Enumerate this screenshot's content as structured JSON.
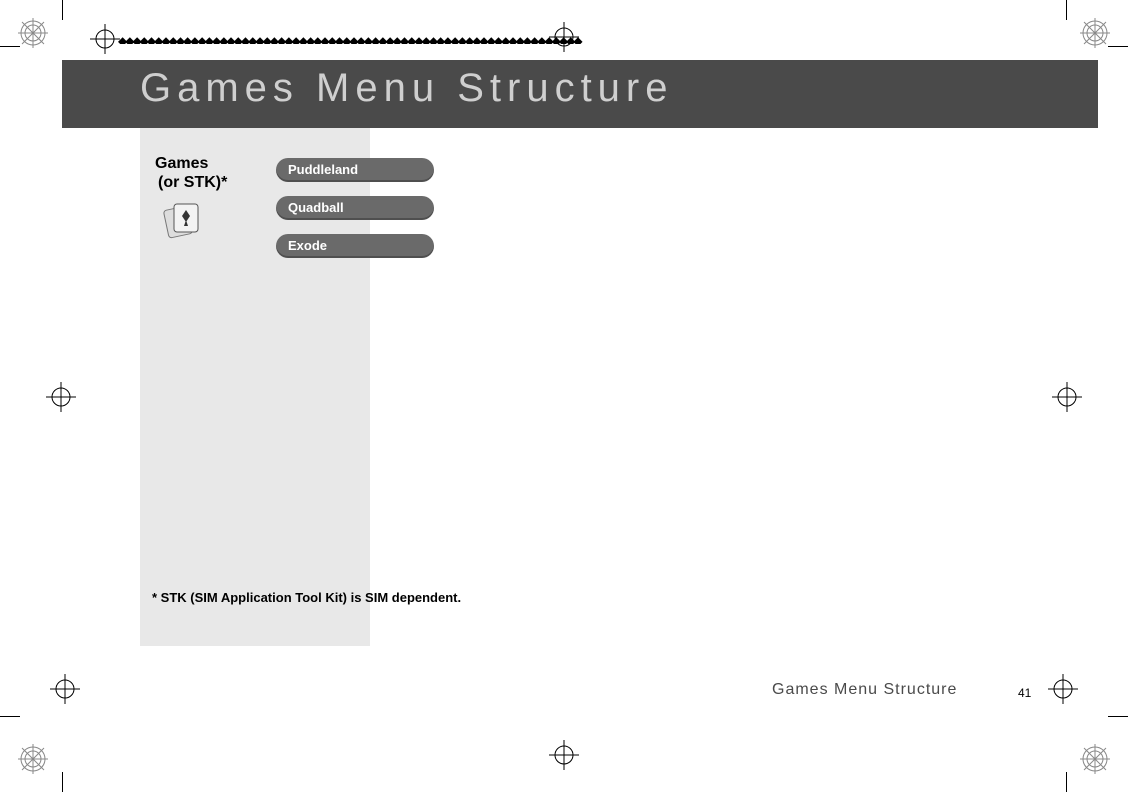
{
  "header": {
    "title": "Games Menu Structure"
  },
  "panel": {
    "label1": "Games",
    "label2": "(or STK)*",
    "icon_name": "cards-icon"
  },
  "menu": {
    "items": [
      {
        "label": "Puddleland"
      },
      {
        "label": "Quadball"
      },
      {
        "label": "Exode"
      }
    ]
  },
  "footnote": "* STK (SIM Application Tool Kit) is SIM dependent.",
  "footer": {
    "section": "Games Menu Structure",
    "page_number": "41"
  },
  "colors": {
    "header_bg": "#4a4a4a",
    "header_text": "#cfcfcf",
    "pill_bg": "#6a6a6a",
    "panel_bg": "#e8e8e8"
  }
}
